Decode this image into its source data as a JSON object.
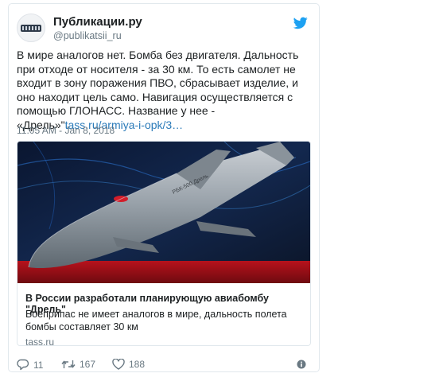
{
  "tweet": {
    "author_name": "Публикации.ру",
    "author_handle": "@publikatsii_ru",
    "text": "В мире аналогов нет. Бомба без двигателя. Дальность при отходе от носителя - за 30 км. То есть самолет не входит в зону поражения ПВО, сбрасывает изделие, и оно находит цель само. Навигация осуществляется с помощью ГЛОНАСС. Название у нее - «Дрель»\"",
    "link_text": "tass.ru/armiya-i-opk/3…",
    "timestamp": "11:05 AM - Jan 8, 2018"
  },
  "card": {
    "image_label": "РБК-500 Дрель",
    "title": "В России разработали планирующую авиабомбу \"Дрель\"",
    "description": "Боеприпас не имеет аналогов в мире, дальность полета бомбы составляет 30 км",
    "domain": "tass.ru"
  },
  "actions": {
    "replies": "11",
    "retweets": "167",
    "likes": "188"
  },
  "colors": {
    "accent": "#1da1f2",
    "link": "#2b7bb9",
    "muted": "#697882",
    "like": "#e0245e"
  },
  "icons": [
    "avatar-logo",
    "twitter-bird-icon",
    "reply-icon",
    "retweet-icon",
    "heart-icon",
    "info-icon"
  ]
}
